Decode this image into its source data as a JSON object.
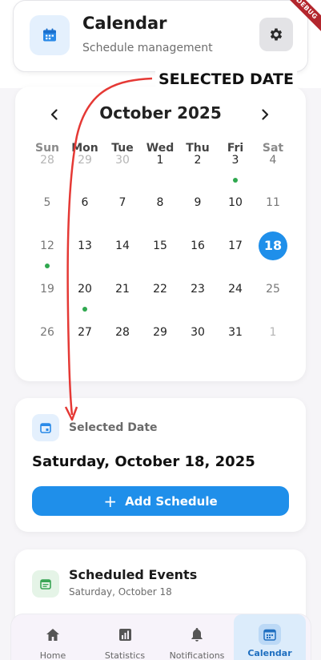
{
  "header": {
    "title": "Calendar",
    "subtitle": "Schedule management",
    "icon": "calendar-icon",
    "settings_icon": "gear-icon",
    "debug_banner": "DEBUG"
  },
  "annotation": {
    "label": "SELECTED DATE",
    "color": "#e53935"
  },
  "calendar": {
    "month_label": "October 2025",
    "prev_icon": "chevron-left-icon",
    "next_icon": "chevron-right-icon",
    "weekdays": [
      "Sun",
      "Mon",
      "Tue",
      "Wed",
      "Thu",
      "Fri",
      "Sat"
    ],
    "weeks": [
      [
        "28",
        "29",
        "30",
        "1",
        "2",
        "3",
        "4"
      ],
      [
        "5",
        "6",
        "7",
        "8",
        "9",
        "10",
        "11"
      ],
      [
        "12",
        "13",
        "14",
        "15",
        "16",
        "17",
        "18"
      ],
      [
        "19",
        "20",
        "21",
        "22",
        "23",
        "24",
        "25"
      ],
      [
        "26",
        "27",
        "28",
        "29",
        "30",
        "31",
        "1"
      ]
    ],
    "selected_day": "18",
    "event_days": [
      "3",
      "12",
      "20"
    ],
    "accent_color": "#1f8fea",
    "event_dot_color": "#2fa84f"
  },
  "selected": {
    "label": "Selected Date",
    "date": "Saturday, October 18, 2025",
    "add_button": "Add Schedule",
    "add_icon": "plus-icon"
  },
  "events": {
    "title": "Scheduled Events",
    "subtitle": "Saturday, October 18",
    "icon": "event-list-icon"
  },
  "bottom_nav": {
    "items": [
      {
        "label": "Home",
        "icon": "home-icon"
      },
      {
        "label": "Statistics",
        "icon": "bar-chart-icon"
      },
      {
        "label": "Notifications",
        "icon": "bell-icon"
      },
      {
        "label": "Calendar",
        "icon": "calendar-icon",
        "active": true
      }
    ]
  }
}
